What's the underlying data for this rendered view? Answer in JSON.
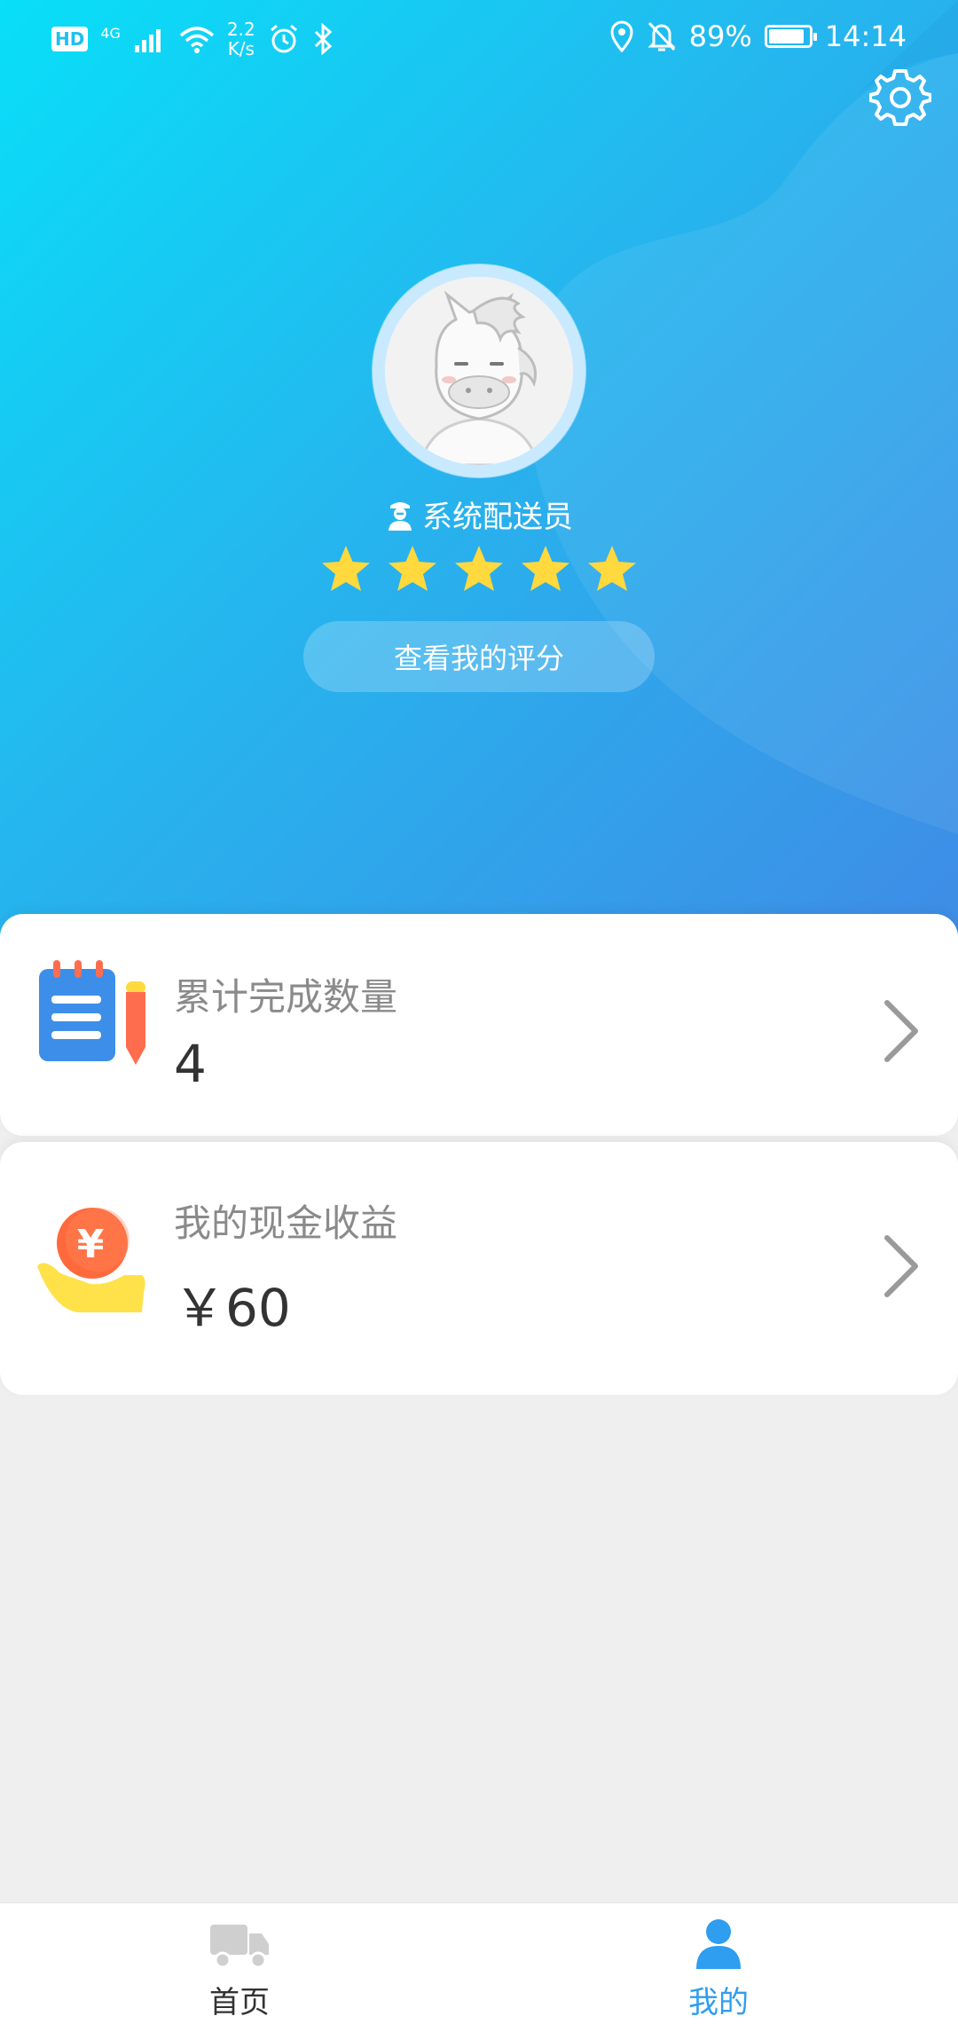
{
  "status_bar": {
    "hd": "HD",
    "network": "4G",
    "speed_value": "2.2",
    "speed_unit": "K/s",
    "battery_percent": "89%",
    "battery_level": 0.89,
    "time": "14:14"
  },
  "profile": {
    "role_label": "系统配送员",
    "star_rating": 5,
    "star_max": 5,
    "rating_button_label": "查看我的评分"
  },
  "cards": [
    {
      "title": "累计完成数量",
      "value": "4",
      "icon": "notepad-pencil-icon"
    },
    {
      "title": "我的现金收益",
      "value": "￥60",
      "icon": "yuan-coin-hand-icon"
    }
  ],
  "tabbar": {
    "items": [
      {
        "label": "首页",
        "icon": "truck-icon",
        "active": false
      },
      {
        "label": "我的",
        "icon": "person-icon",
        "active": true
      }
    ]
  },
  "colors": {
    "accent": "#2f9df0",
    "star": "#ffd93d",
    "inactive": "#333333"
  }
}
